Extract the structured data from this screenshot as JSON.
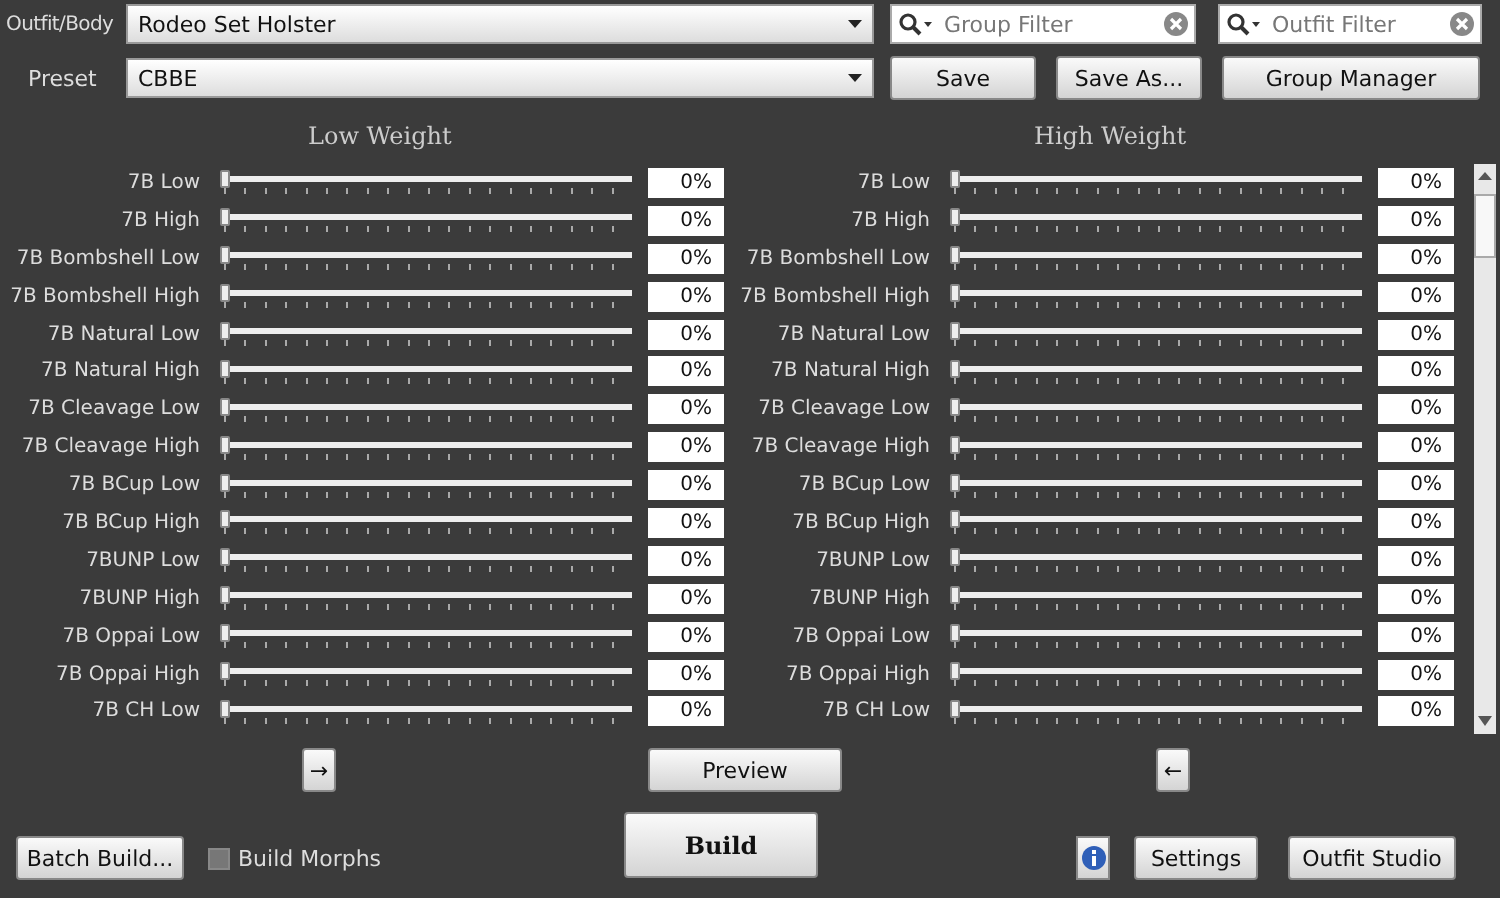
{
  "outfit_body": {
    "label": "Outfit/Body",
    "value": "Rodeo Set Holster"
  },
  "preset": {
    "label": "Preset",
    "value": "CBBE"
  },
  "group_filter": {
    "placeholder": "Group Filter"
  },
  "outfit_filter": {
    "placeholder": "Outfit Filter"
  },
  "buttons": {
    "save": "Save",
    "save_as": "Save As...",
    "group_manager": "Group Manager",
    "copy_right": "→",
    "preview": "Preview",
    "copy_left": "←",
    "batch_build": "Batch Build...",
    "build": "Build",
    "settings": "Settings",
    "outfit_studio": "Outfit Studio"
  },
  "build_morphs": {
    "label": "Build Morphs",
    "checked": false
  },
  "panels": [
    {
      "title": "Low Weight",
      "sliders": [
        {
          "name": "7B Low",
          "level": 0,
          "reading": "0%"
        },
        {
          "name": "7B High",
          "level": 0,
          "reading": "0%"
        },
        {
          "name": "7B Bombshell Low",
          "level": 0,
          "reading": "0%"
        },
        {
          "name": "7B Bombshell High",
          "level": 0,
          "reading": "0%"
        },
        {
          "name": "7B Natural Low",
          "level": 0,
          "reading": "0%"
        },
        {
          "name": "7B Natural High",
          "level": 0,
          "reading": "0%"
        },
        {
          "name": "7B Cleavage Low",
          "level": 0,
          "reading": "0%"
        },
        {
          "name": "7B Cleavage High",
          "level": 0,
          "reading": "0%"
        },
        {
          "name": "7B BCup Low",
          "level": 0,
          "reading": "0%"
        },
        {
          "name": "7B BCup High",
          "level": 0,
          "reading": "0%"
        },
        {
          "name": "7BUNP Low",
          "level": 0,
          "reading": "0%"
        },
        {
          "name": "7BUNP High",
          "level": 0,
          "reading": "0%"
        },
        {
          "name": "7B Oppai Low",
          "level": 0,
          "reading": "0%"
        },
        {
          "name": "7B Oppai High",
          "level": 0,
          "reading": "0%"
        },
        {
          "name": "7B CH Low",
          "level": 0,
          "reading": "0%"
        }
      ]
    },
    {
      "title": "High Weight",
      "sliders": [
        {
          "name": "7B Low",
          "level": 0,
          "reading": "0%"
        },
        {
          "name": "7B High",
          "level": 0,
          "reading": "0%"
        },
        {
          "name": "7B Bombshell Low",
          "level": 0,
          "reading": "0%"
        },
        {
          "name": "7B Bombshell High",
          "level": 0,
          "reading": "0%"
        },
        {
          "name": "7B Natural Low",
          "level": 0,
          "reading": "0%"
        },
        {
          "name": "7B Natural High",
          "level": 0,
          "reading": "0%"
        },
        {
          "name": "7B Cleavage Low",
          "level": 0,
          "reading": "0%"
        },
        {
          "name": "7B Cleavage High",
          "level": 0,
          "reading": "0%"
        },
        {
          "name": "7B BCup Low",
          "level": 0,
          "reading": "0%"
        },
        {
          "name": "7B BCup High",
          "level": 0,
          "reading": "0%"
        },
        {
          "name": "7BUNP Low",
          "level": 0,
          "reading": "0%"
        },
        {
          "name": "7BUNP High",
          "level": 0,
          "reading": "0%"
        },
        {
          "name": "7B Oppai Low",
          "level": 0,
          "reading": "0%"
        },
        {
          "name": "7B Oppai High",
          "level": 0,
          "reading": "0%"
        },
        {
          "name": "7B CH Low",
          "level": 0,
          "reading": "0%"
        }
      ]
    }
  ]
}
